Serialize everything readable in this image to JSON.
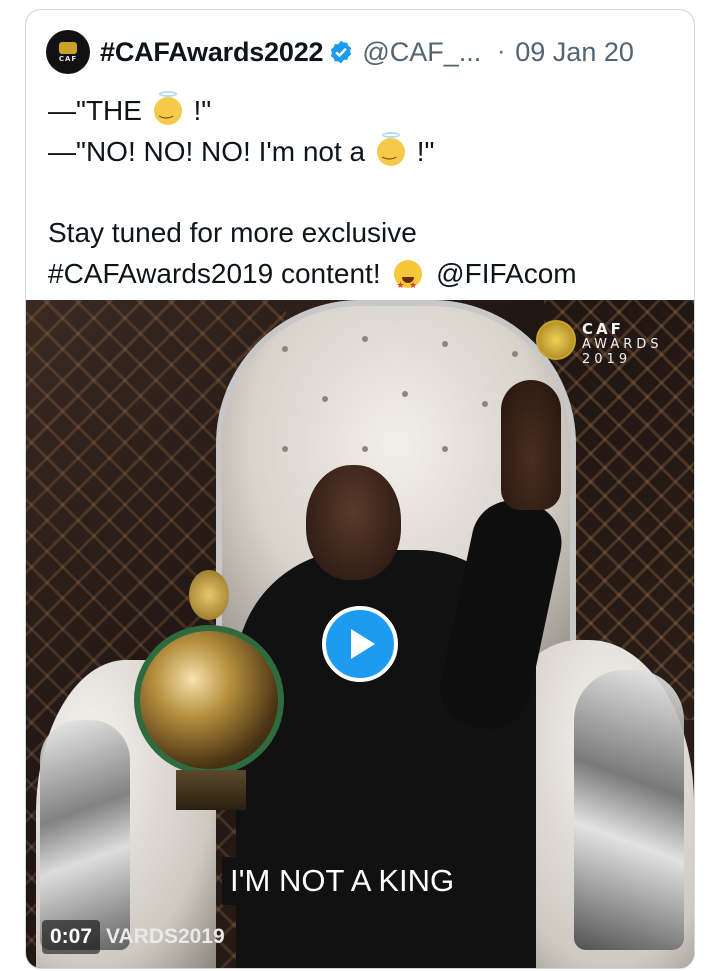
{
  "tweet": {
    "author_name": "#CAFAwards2022",
    "author_handle": "@CAF_...",
    "separator": "·",
    "date": "09 Jan 20",
    "avatar_text": "CAF",
    "verified": true,
    "lines": {
      "l1_a": "—\"THE",
      "l1_b": "!\"",
      "l2_a": "—\"NO! NO! NO! I'm not a",
      "l2_b": "!\"",
      "l3": "Stay tuned for more exclusive",
      "l4_hashtag": "#CAFAwards2019",
      "l4_text": "content!",
      "l4_mention": "@FIFAcom"
    },
    "emojis": [
      "angel-emoji",
      "angel-emoji",
      "star-struck-emoji"
    ]
  },
  "media": {
    "brand_line1": "CAF",
    "brand_line2": "AWARDS",
    "brand_line3": "2019",
    "caption": "I'M NOT A KING",
    "timer": "0:07",
    "overlay_tag": "VARDS2019",
    "play_icon": "play-icon"
  },
  "colors": {
    "accent": "#1d9bf0",
    "text_secondary": "#536471",
    "border": "#cfd9de"
  }
}
